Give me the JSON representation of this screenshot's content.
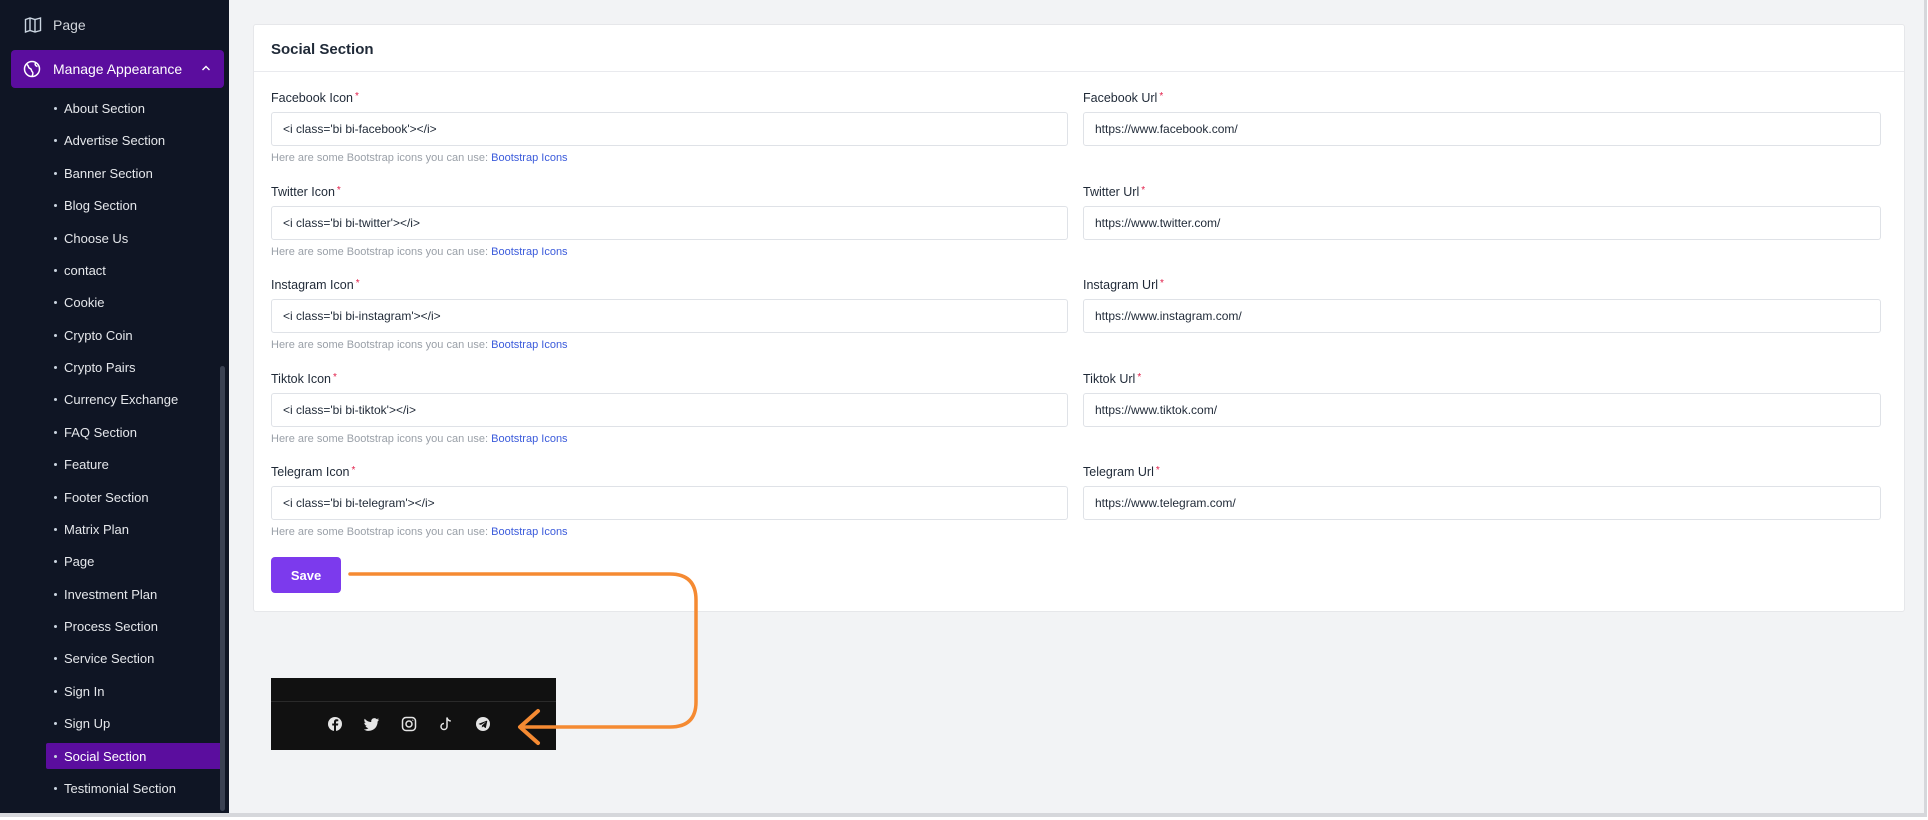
{
  "sidebar": {
    "top_item": "Page",
    "manage": "Manage Appearance",
    "items": [
      {
        "label": "About Section"
      },
      {
        "label": "Advertise Section"
      },
      {
        "label": "Banner Section"
      },
      {
        "label": "Blog Section"
      },
      {
        "label": "Choose Us"
      },
      {
        "label": "contact"
      },
      {
        "label": "Cookie"
      },
      {
        "label": "Crypto Coin"
      },
      {
        "label": "Crypto Pairs"
      },
      {
        "label": "Currency Exchange"
      },
      {
        "label": "FAQ Section"
      },
      {
        "label": "Feature"
      },
      {
        "label": "Footer Section"
      },
      {
        "label": "Matrix Plan"
      },
      {
        "label": "Page"
      },
      {
        "label": "Investment Plan"
      },
      {
        "label": "Process Section"
      },
      {
        "label": "Service Section"
      },
      {
        "label": "Sign In"
      },
      {
        "label": "Sign Up"
      },
      {
        "label": "Social Section"
      },
      {
        "label": "Testimonial Section"
      }
    ],
    "active_item": "Social Section"
  },
  "card": {
    "title": "Social Section",
    "hint_text": "Here are some Bootstrap icons you can use:",
    "hint_link": "Bootstrap Icons",
    "fields": [
      {
        "icon_label": "Facebook Icon",
        "icon_value": "<i class='bi bi-facebook'></i>",
        "url_label": "Facebook Url",
        "url_value": "https://www.facebook.com/"
      },
      {
        "icon_label": "Twitter Icon",
        "icon_value": "<i class='bi bi-twitter'></i>",
        "url_label": "Twitter Url",
        "url_value": "https://www.twitter.com/"
      },
      {
        "icon_label": "Instagram Icon",
        "icon_value": "<i class='bi bi-instagram'></i>",
        "url_label": "Instagram Url",
        "url_value": "https://www.instagram.com/"
      },
      {
        "icon_label": "Tiktok Icon",
        "icon_value": "<i class='bi bi-tiktok'></i>",
        "url_label": "Tiktok Url",
        "url_value": "https://www.tiktok.com/"
      },
      {
        "icon_label": "Telegram Icon",
        "icon_value": "<i class='bi bi-telegram'></i>",
        "url_label": "Telegram Url",
        "url_value": "https://www.telegram.com/"
      }
    ],
    "save_label": "Save"
  },
  "preview": {
    "icons": [
      "facebook-icon",
      "twitter-icon",
      "instagram-icon",
      "tiktok-icon",
      "telegram-icon"
    ]
  },
  "colors": {
    "sidebar_bg": "#0f1524",
    "accent_purple": "#5b0d9e",
    "save_button": "#7c3aed",
    "annotation_arrow": "#f58a32"
  }
}
